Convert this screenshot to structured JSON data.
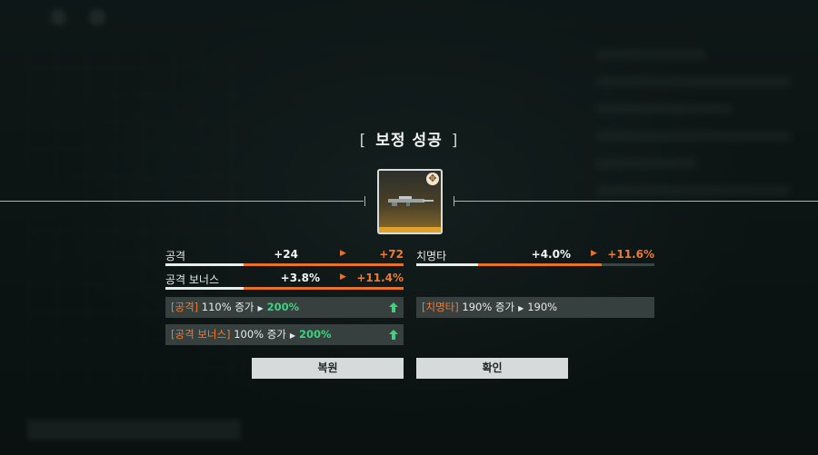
{
  "dialog": {
    "title": "보정 성공",
    "bracket_left": "[",
    "bracket_right": "]"
  },
  "item": {
    "icon": "rifle-icon",
    "badge_icon": "crosshair-badge-icon",
    "rarity_color": "#e0a22b"
  },
  "stats": [
    {
      "label": "공격",
      "from": "+24",
      "to": "+72",
      "progress_before": 0.33,
      "progress_after": 1.0
    },
    {
      "label": "치명타",
      "from": "+4.0%",
      "to": "+11.6%",
      "progress_before": 0.26,
      "progress_after": 0.78
    },
    {
      "label": "공격 보너스",
      "from": "+3.8%",
      "to": "+11.4%",
      "progress_before": 0.33,
      "progress_after": 1.0
    }
  ],
  "effects": [
    {
      "tag": "[공격]",
      "text": "110% 증가",
      "new_value": "200%",
      "increased": true
    },
    {
      "tag": "[치명타]",
      "text": "190% 증가",
      "new_value": "190%",
      "increased": false
    },
    {
      "tag": "[공격 보너스]",
      "text": "100% 증가",
      "new_value": "200%",
      "increased": true
    }
  ],
  "buttons": {
    "restore": "복원",
    "confirm": "확인"
  },
  "colors": {
    "accent_orange": "#e8722c",
    "increase_green": "#3ed17e",
    "button_bg": "#d7dada"
  }
}
